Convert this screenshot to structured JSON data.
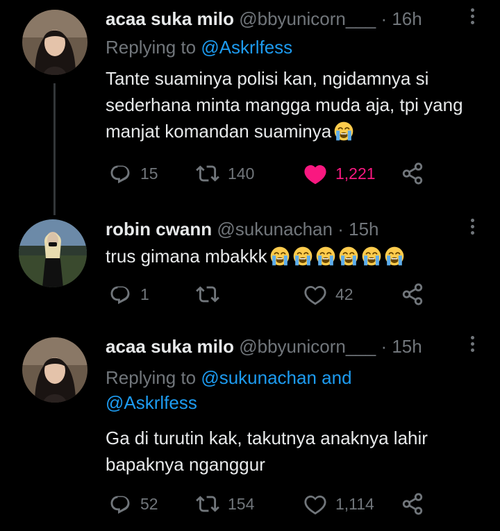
{
  "replies": [
    {
      "name": "acaa suka milo",
      "handle": "@bbyunicorn___",
      "sep": "·",
      "time": "16h",
      "replying_prefix": "Replying to",
      "replying_to": "@Askrlfess",
      "text": "Tante suaminya polisi kan, ngidamnya si sederhana minta mangga muda aja, tpi yang manjat komandan suaminya",
      "emoji_count": 1,
      "replies": "15",
      "retweets": "140",
      "likes": "1,221",
      "liked": true
    },
    {
      "name": "robin cwann",
      "handle": "@sukunachan",
      "sep": "·",
      "time": "15h",
      "text": "trus gimana mbakkk",
      "emoji_count": 6,
      "replies": "1",
      "retweets": "",
      "likes": "42",
      "liked": false
    },
    {
      "name": "acaa suka milo",
      "handle": "@bbyunicorn___",
      "sep": "·",
      "time": "15h",
      "replying_prefix": "Replying to",
      "replying_to": "@sukunachan and @Askrlfess",
      "text": "Ga di turutin kak, takutnya anaknya lahir bapaknya nganggur",
      "emoji_count": 0,
      "replies": "52",
      "retweets": "154",
      "likes": "1,114",
      "liked": false
    }
  ],
  "icons": {
    "reply": "reply-icon",
    "retweet": "retweet-icon",
    "like": "heart-icon",
    "share": "share-icon",
    "more": "more-icon",
    "emoji": "loudly-crying-face-emoji"
  },
  "colors": {
    "background": "#000000",
    "text": "#e7e9ea",
    "muted": "#71767b",
    "link": "#1d9bf0",
    "like": "#f91880"
  }
}
